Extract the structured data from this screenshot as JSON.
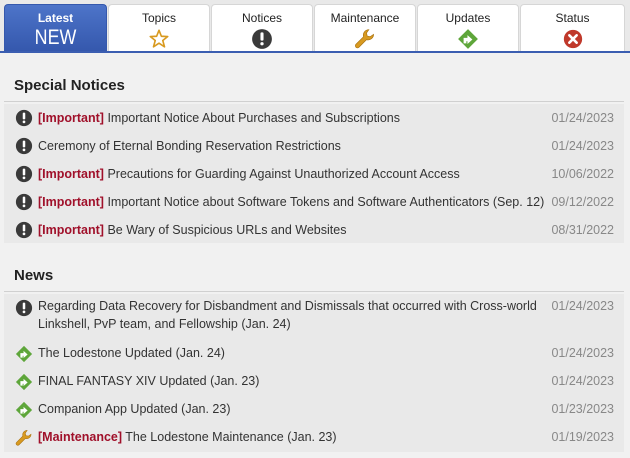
{
  "tabs": [
    {
      "label": "Latest",
      "sub": "NEW",
      "icon": "new-text",
      "active": true
    },
    {
      "label": "Topics",
      "icon": "star-icon"
    },
    {
      "label": "Notices",
      "icon": "exclamation-icon"
    },
    {
      "label": "Maintenance",
      "icon": "wrench-icon"
    },
    {
      "label": "Updates",
      "icon": "update-arrow-icon"
    },
    {
      "label": "Status",
      "icon": "x-circle-icon"
    }
  ],
  "colors": {
    "accent": "#3b5eb1",
    "important": "#a0102a",
    "updates_green": "#5ea63a",
    "maintenance_gold": "#d89a20",
    "status_red": "#c0392b"
  },
  "special_notices": {
    "title": "Special Notices",
    "items": [
      {
        "icon": "notice-icon",
        "tag": "[Important]",
        "text": "Important Notice About Purchases and Subscriptions",
        "date": "01/24/2023"
      },
      {
        "icon": "notice-icon",
        "tag": "",
        "text": "Ceremony of Eternal Bonding Reservation Restrictions",
        "date": "01/24/2023"
      },
      {
        "icon": "notice-icon",
        "tag": "[Important]",
        "text": "Precautions for Guarding Against Unauthorized Account Access",
        "date": "10/06/2022"
      },
      {
        "icon": "notice-icon",
        "tag": "[Important]",
        "text": "Important Notice about Software Tokens and Software Authenticators (Sep. 12)",
        "date": "09/12/2022"
      },
      {
        "icon": "notice-icon",
        "tag": "[Important]",
        "text": "Be Wary of Suspicious URLs and Websites",
        "date": "08/31/2022"
      }
    ]
  },
  "news": {
    "title": "News",
    "items": [
      {
        "icon": "notice-icon",
        "tag": "",
        "text": "Regarding Data Recovery for Disbandment and Dismissals that occurred with Cross-world",
        "text2": "Linkshell, PvP team, and Fellowship (Jan. 24)",
        "date": "01/24/2023"
      },
      {
        "icon": "update-icon",
        "tag": "",
        "text": "The Lodestone Updated (Jan. 24)",
        "date": "01/24/2023"
      },
      {
        "icon": "update-icon",
        "tag": "",
        "text": "FINAL FANTASY XIV Updated (Jan. 23)",
        "date": "01/24/2023"
      },
      {
        "icon": "update-icon",
        "tag": "",
        "text": "Companion App Updated (Jan. 23)",
        "date": "01/23/2023"
      },
      {
        "icon": "wrench-icon",
        "tag": "[Maintenance]",
        "text": "The Lodestone Maintenance (Jan. 23)",
        "date": "01/19/2023"
      }
    ]
  }
}
